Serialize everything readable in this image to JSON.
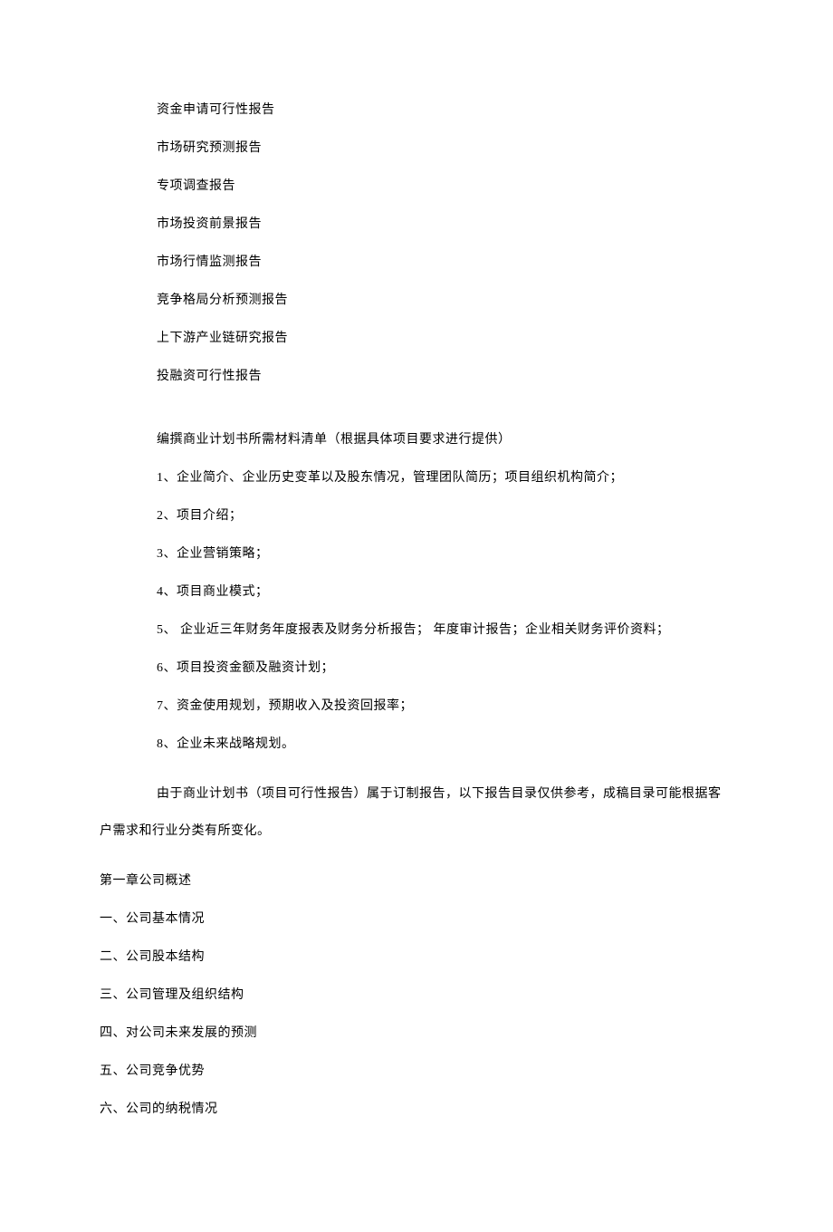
{
  "reports": [
    "资金申请可行性报告",
    "市场研究预测报告",
    "专项调查报告",
    "市场投资前景报告",
    "市场行情监测报告",
    "竞争格局分析预测报告",
    "上下游产业链研究报告",
    "投融资可行性报告"
  ],
  "checklist_title": "编撰商业计划书所需材料清单（根据具体项目要求进行提供）",
  "checklist": [
    "1、企业简介、企业历史变革以及股东情况，管理团队简历；项目组织机构简介；",
    "2、项目介绍；",
    "3、企业营销策略；",
    "4、项目商业模式；",
    "5、 企业近三年财务年度报表及财务分析报告；          年度审计报告；企业相关财务评价资料；",
    "6、项目投资金额及融资计划；",
    "7、资金使用规划，预期收入及投资回报率；",
    "8、企业未来战略规划。"
  ],
  "note": "由于商业计划书（项目可行性报告）属于订制报告，以下报告目录仅供参考，成稿目录可能根据客户需求和行业分类有所变化。",
  "chapter1_title": "第一章公司概述",
  "chapter1_items": [
    "一、公司基本情况",
    "二、公司股本结构",
    "三、公司管理及组织结构",
    "四、对公司未来发展的预测",
    "五、公司竞争优势",
    "六、公司的纳税情况"
  ]
}
